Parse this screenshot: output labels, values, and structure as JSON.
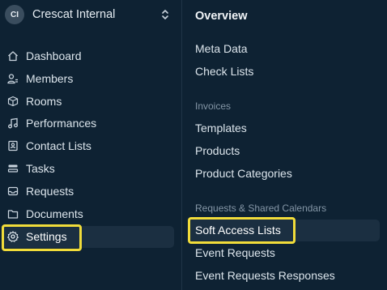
{
  "workspace": {
    "initials": "CI",
    "name": "Crescat Internal",
    "switch_icon": "chevron-up-down-icon"
  },
  "nav": {
    "items": [
      {
        "label": "Dashboard",
        "icon": "home-icon"
      },
      {
        "label": "Members",
        "icon": "users-icon"
      },
      {
        "label": "Rooms",
        "icon": "cube-icon"
      },
      {
        "label": "Performances",
        "icon": "music-note-icon"
      },
      {
        "label": "Contact Lists",
        "icon": "contact-book-icon"
      },
      {
        "label": "Tasks",
        "icon": "list-icon"
      },
      {
        "label": "Requests",
        "icon": "inbox-icon"
      },
      {
        "label": "Documents",
        "icon": "folder-icon"
      },
      {
        "label": "Settings",
        "icon": "gear-icon"
      }
    ],
    "active": "Settings"
  },
  "settings_panel": {
    "title": "Overview",
    "general": [
      "Meta Data",
      "Check Lists"
    ],
    "invoices_heading": "Invoices",
    "invoices": [
      "Templates",
      "Products",
      "Product Categories"
    ],
    "requests_heading": "Requests & Shared Calendars",
    "requests": [
      "Soft Access Lists",
      "Event Requests",
      "Event Requests Responses"
    ],
    "active": "Soft Access Lists"
  },
  "highlight_color": "#f1dc3a"
}
